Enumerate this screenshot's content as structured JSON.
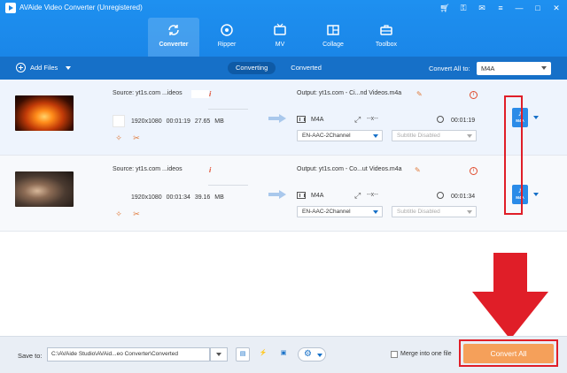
{
  "window": {
    "title": "AVAide Video Converter (Unregistered)"
  },
  "nav": {
    "tabs": [
      {
        "label": "Converter",
        "icon": "converter-icon",
        "active": true
      },
      {
        "label": "Ripper",
        "icon": "disc-icon",
        "active": false
      },
      {
        "label": "MV",
        "icon": "tv-icon",
        "active": false
      },
      {
        "label": "Collage",
        "icon": "collage-icon",
        "active": false
      },
      {
        "label": "Toolbox",
        "icon": "toolbox-icon",
        "active": false
      }
    ]
  },
  "toolbar": {
    "add_files": "Add Files",
    "converting": "Converting",
    "converted": "Converted",
    "convert_all_to": "Convert All to:",
    "format": "M4A"
  },
  "files": [
    {
      "source": "Source: yt1s.com ...ideos",
      "resolution": "1920x1080",
      "duration": "00:01:19",
      "size": "27.65 MB",
      "output": "Output: yt1s.com - Ci...nd Videos.m4a",
      "out_format": "M4A",
      "out_res": "--x--",
      "out_duration": "00:01:19",
      "audio_track": "EN-AAC-2Channel",
      "subtitle": "Subtitle Disabled",
      "format_icon_label": "M4A"
    },
    {
      "source": "Source: yt1s.com ...ideos",
      "resolution": "1920x1080",
      "duration": "00:01:34",
      "size": "39.16 MB",
      "output": "Output: yt1s.com - Co...ut Videos.m4a",
      "out_format": "M4A",
      "out_res": "--x--",
      "out_duration": "00:01:34",
      "audio_track": "EN-AAC-2Channel",
      "subtitle": "Subtitle Disabled",
      "format_icon_label": "M4A"
    }
  ],
  "bottom": {
    "save_to": "Save to:",
    "path": "C:\\AVAide Studio\\AVAid...eo Converter\\Converted",
    "merge": "Merge into one file",
    "convert_all": "Convert All"
  },
  "colors": {
    "header_blue": "#1a86e8",
    "toolbar_blue": "#1670c8",
    "convert_orange": "#f5a05a",
    "highlight_red": "#e01e28"
  }
}
